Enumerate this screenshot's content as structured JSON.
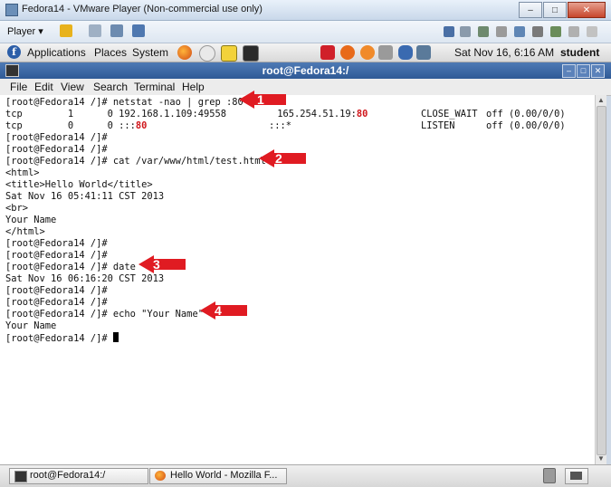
{
  "vmware": {
    "title": "Fedora14 - VMware Player (Non-commercial use only)",
    "player_menu": "Player ▾",
    "window_controls": {
      "minimize": "–",
      "maximize": "□",
      "close": "✕"
    }
  },
  "panel": {
    "menus": [
      "Applications",
      "Places",
      "System"
    ],
    "clock": "Sat Nov 16,  6:16 AM",
    "user": "student"
  },
  "terminal": {
    "title": "root@Fedora14:/",
    "menu": [
      "File",
      "Edit",
      "View",
      "Search",
      "Terminal",
      "Help"
    ],
    "controls": {
      "minimize": "–",
      "maximize": "□",
      "close": "✕"
    }
  },
  "lines": [
    "[root@Fedora14 /]# netstat -nao | grep :80",
    "tcp        1      0 192.168.1.109:49558         165.254.51.19:",
    "tcp        0      0 :::",
    "[root@Fedora14 /]#",
    "[root@Fedora14 /]#",
    "[root@Fedora14 /]# cat /var/www/html/test.html",
    "<html>",
    "<title>Hello World</title>",
    "Sat Nov 16 05:41:11 CST 2013",
    "<br>",
    "Your Name",
    "</html>",
    "[root@Fedora14 /]#",
    "[root@Fedora14 /]#",
    "[root@Fedora14 /]# date",
    "Sat Nov 16 06:16:20 CST 2013",
    "[root@Fedora14 /]#",
    "[root@Fedora14 /]#",
    "[root@Fedora14 /]# echo \"Your Name\"",
    "Your Name",
    "[root@Fedora14 /]# "
  ],
  "netstat_row1": {
    "port": "80",
    "state": "CLOSE_WAIT",
    "timer": "off (0.00/0/0)"
  },
  "netstat_row2": {
    "port": "80",
    "foreign": ":::*",
    "state": "LISTEN",
    "timer": "off (0.00/0/0)"
  },
  "annotations": [
    "1",
    "2",
    "3",
    "4"
  ],
  "taskbar": {
    "tasks": [
      "root@Fedora14:/",
      "Hello World - Mozilla F..."
    ]
  },
  "colors": {
    "highlight": "#d0151a",
    "arrow": "#e01b22",
    "titlebar": "#2f5a96"
  },
  "icons": [
    "fedora-icon",
    "firefox-icon",
    "terminal-icon",
    "trash-icon",
    "workspace-icon"
  ]
}
